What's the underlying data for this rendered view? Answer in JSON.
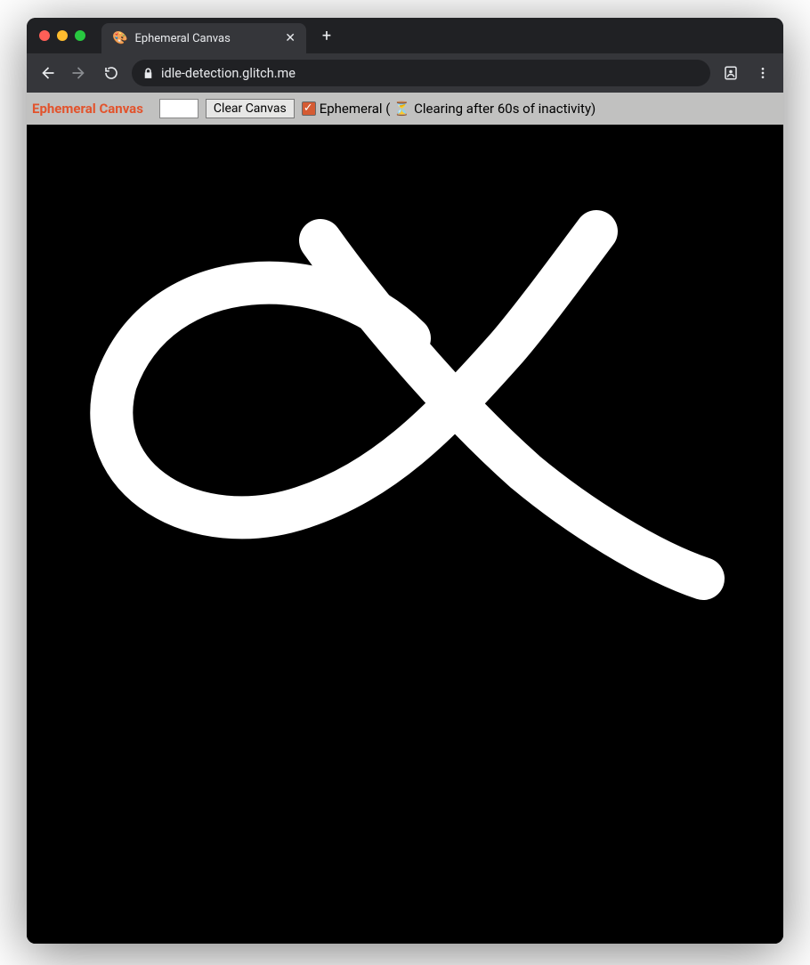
{
  "browser": {
    "tab": {
      "favicon": "🎨",
      "title": "Ephemeral Canvas"
    },
    "address": "idle-detection.glitch.me"
  },
  "app": {
    "title": "Ephemeral Canvas",
    "clear_label": "Clear Canvas",
    "ephemeral_prefix": "Ephemeral (",
    "hourglass": "⏳",
    "ephemeral_status": " Clearing after 60s of inactivity)",
    "ephemeral_checked": true,
    "color_value": "#ffffff"
  }
}
